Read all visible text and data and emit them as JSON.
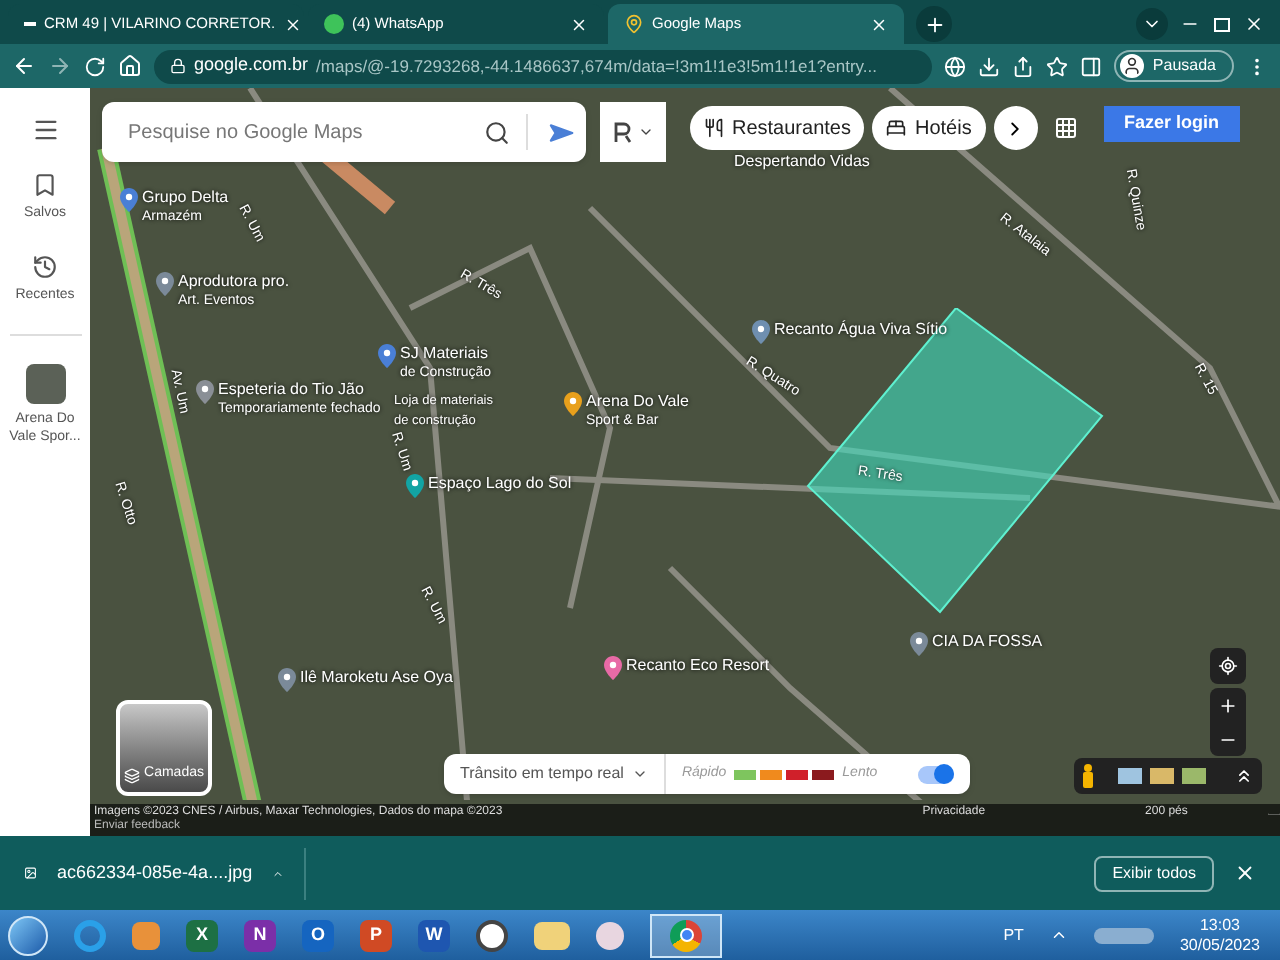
{
  "browser": {
    "tabs": [
      {
        "title": "CRM 49 | VILARINO CORRETOR.",
        "selected": false
      },
      {
        "title": "(4) WhatsApp",
        "selected": false
      },
      {
        "title": "Google Maps",
        "selected": true
      }
    ],
    "url_host": "google.com.br",
    "url_path": "/maps/@-19.7293268,-44.1486637,674m/data=!3m1!1e3!5m1!1e1?entry...",
    "profile": "Pausada"
  },
  "sidebar": {
    "items": [
      {
        "kind": "saved",
        "label": "Salvos"
      },
      {
        "kind": "recent",
        "label": "Recentes"
      }
    ],
    "recent_place": "Arena Do Vale Spor..."
  },
  "search": {
    "placeholder": "Pesquise no Google Maps"
  },
  "chips": [
    {
      "kind": "food",
      "label": "Restaurantes"
    },
    {
      "kind": "hotel",
      "label": "Hotéis"
    }
  ],
  "login_button": "Fazer login",
  "map": {
    "places": [
      {
        "kind": "label",
        "name": "Despertando Vidas"
      },
      {
        "kind": "place",
        "name": "Grupo Delta",
        "detail": "Armazém",
        "color": "#4a7fd6"
      },
      {
        "kind": "place",
        "name": "Aprodutora pro.",
        "detail": "Art. Eventos",
        "color": "#7b8a99"
      },
      {
        "kind": "place",
        "name": "SJ Materiais",
        "detail": "de Construção",
        "color": "#4a7fd6"
      },
      {
        "kind": "note",
        "name": "Loja de materiais",
        "detail": "de construção"
      },
      {
        "kind": "place",
        "name": "Espeteria do Tio Jão",
        "detail": "Temporariamente fechado",
        "color": "#8a8f96"
      },
      {
        "kind": "place",
        "name": "Arena Do Vale",
        "detail": "Sport & Bar",
        "color": "#e8a01c"
      },
      {
        "kind": "place",
        "name": "Espaço Lago do Sol",
        "color": "#12a4a4"
      },
      {
        "kind": "place",
        "name": "Recanto Água Viva Sítio",
        "color": "#6f8fb0"
      },
      {
        "kind": "place",
        "name": "Ilê Maroketu Ase Oya",
        "color": "#7b8a99"
      },
      {
        "kind": "place",
        "name": "Recanto Eco Resort",
        "color": "#e86aa6"
      },
      {
        "kind": "place",
        "name": "CIA DA FOSSA",
        "color": "#7b8a99"
      }
    ],
    "streets": [
      "R. Um",
      "R. Três",
      "Av. Um",
      "R. Um",
      "R. Quatro",
      "R. Três",
      "R. Atalaia",
      "R. Quinze",
      "R. 15",
      "R. Otto",
      "R. Um"
    ]
  },
  "layers_button": "Camadas",
  "traffic": {
    "title": "Trânsito em tempo real",
    "fast": "Rápido",
    "slow": "Lento",
    "on": true
  },
  "attribution": "Imagens ©2023 CNES / Airbus, Maxar Technologies, Dados do mapa ©2023",
  "feedback": "Enviar feedback",
  "privacy": "Privacidade",
  "scale": "200 pés",
  "download": {
    "file": "ac662334-085e-4a....jpg",
    "show_all": "Exibir todos"
  },
  "taskbar": {
    "apps": [
      {
        "kind": "ie"
      },
      {
        "kind": "media"
      },
      {
        "kind": "office",
        "glyph": "X",
        "color": "#1d7044"
      },
      {
        "kind": "office",
        "glyph": "N",
        "color": "#7b2fa8"
      },
      {
        "kind": "office",
        "glyph": "O",
        "color": "#1565c0"
      },
      {
        "kind": "office",
        "glyph": "P",
        "color": "#d04a24"
      },
      {
        "kind": "office",
        "glyph": "W",
        "color": "#1e56b0"
      },
      {
        "kind": "whatsapp"
      },
      {
        "kind": "folder"
      },
      {
        "kind": "paint"
      },
      {
        "kind": "chrome",
        "selected": true
      }
    ],
    "language": "PT",
    "time": "13:03",
    "date": "30/05/2023"
  }
}
